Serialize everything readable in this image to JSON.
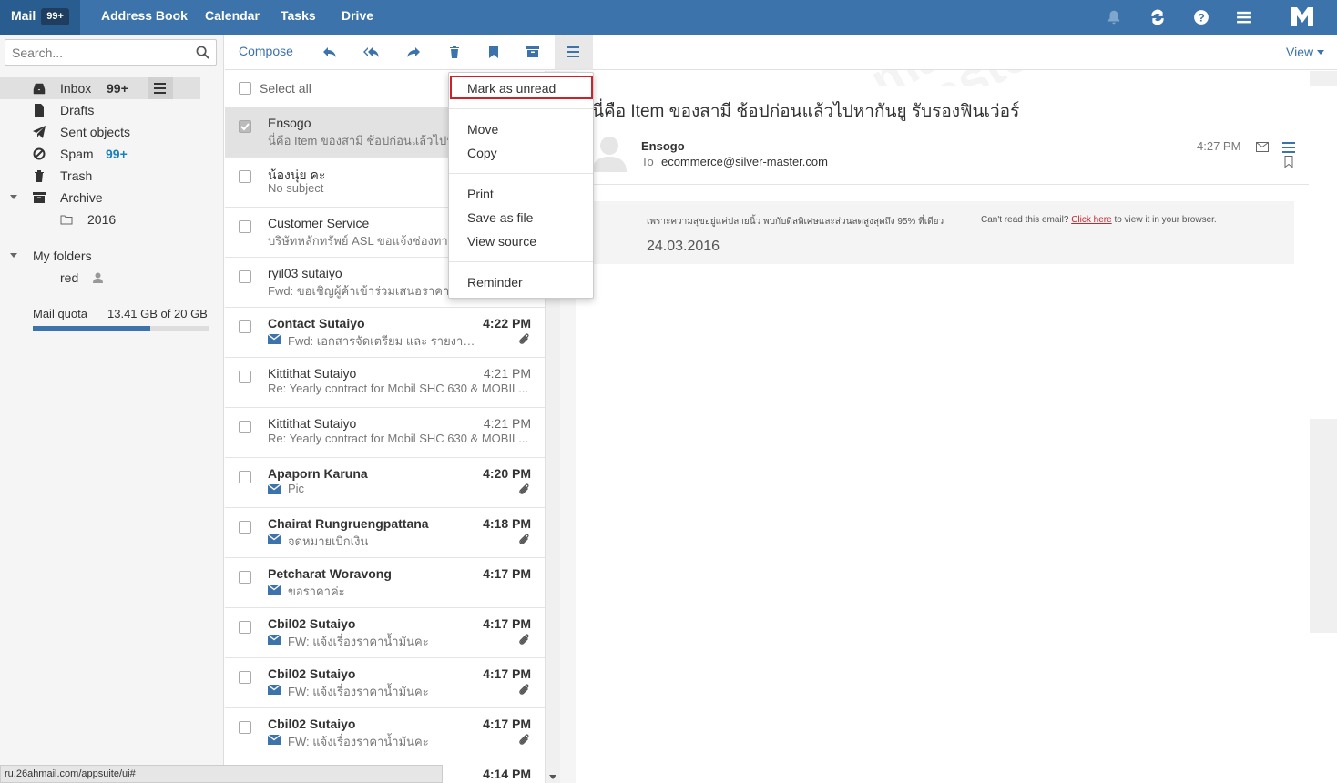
{
  "topbar": {
    "apps": [
      {
        "label": "Mail",
        "badge": "99+"
      },
      {
        "label": "Address Book"
      },
      {
        "label": "Calendar"
      },
      {
        "label": "Tasks"
      },
      {
        "label": "Drive"
      }
    ],
    "icons": [
      "bell-icon",
      "refresh-icon",
      "help-icon",
      "menu-icon",
      "mailmaster-logo"
    ]
  },
  "search": {
    "placeholder": "Search..."
  },
  "folders": {
    "inbox": {
      "label": "Inbox",
      "count": "99+"
    },
    "drafts": {
      "label": "Drafts"
    },
    "sent": {
      "label": "Sent objects"
    },
    "spam": {
      "label": "Spam",
      "count": "99+"
    },
    "trash": {
      "label": "Trash"
    },
    "archive": {
      "label": "Archive"
    },
    "archive_2016": {
      "label": "2016"
    },
    "my_folders": {
      "label": "My folders"
    },
    "red": {
      "label": "red"
    }
  },
  "quota": {
    "label": "Mail quota",
    "value": "13.41 GB of 20 GB",
    "fraction": 0.67
  },
  "toolbar": {
    "compose": "Compose",
    "view": "View"
  },
  "list": {
    "select_all": "Select all",
    "rows": [
      {
        "from": "Ensogo",
        "subject": "นี่คือ Item ของสามี ช้อปก่อนแล้วไปหากันยู",
        "time": "",
        "unread": false,
        "selected": true,
        "attach": false
      },
      {
        "from": "น้องนุ่ย คะ",
        "subject": "No subject",
        "time": "",
        "unread": false,
        "selected": false,
        "attach": false
      },
      {
        "from": "Customer Service",
        "subject": "บริษัทหลักทรัพย์ ASL ขอแจ้งช่องทางการ",
        "time": "",
        "unread": false,
        "selected": false,
        "attach": false
      },
      {
        "from": "ryil03 sutaiyo",
        "subject": "Fwd: ขอเชิญผู้ค้าเข้าร่วมเสนอราคางาน",
        "time": "",
        "unread": false,
        "selected": false,
        "attach": false
      },
      {
        "from": "Contact Sutaiyo",
        "subject": "Fwd: เอกสารจัดเตรียม และ รายงานการประ...",
        "time": "4:22 PM",
        "unread": true,
        "selected": false,
        "attach": true
      },
      {
        "from": "Kittithat Sutaiyo",
        "subject": "Re: Yearly contract for Mobil SHC 630 & MOBIL...",
        "time": "4:21 PM",
        "unread": false,
        "selected": false,
        "attach": false
      },
      {
        "from": "Kittithat Sutaiyo",
        "subject": "Re: Yearly contract for Mobil SHC 630 & MOBIL...",
        "time": "4:21 PM",
        "unread": false,
        "selected": false,
        "attach": false
      },
      {
        "from": "Apaporn Karuna",
        "subject": "Pic",
        "time": "4:20 PM",
        "unread": true,
        "selected": false,
        "attach": true
      },
      {
        "from": "Chairat Rungruengpattana",
        "subject": "จดหมายเบิกเงิน",
        "time": "4:18 PM",
        "unread": true,
        "selected": false,
        "attach": true
      },
      {
        "from": "Petcharat Woravong",
        "subject": "ขอราคาค่ะ",
        "time": "4:17 PM",
        "unread": true,
        "selected": false,
        "attach": false
      },
      {
        "from": "Cbil02 Sutaiyo",
        "subject": "FW: แจ้งเรื่องราคาน้ำมันคะ",
        "time": "4:17 PM",
        "unread": true,
        "selected": false,
        "attach": true
      },
      {
        "from": "Cbil02 Sutaiyo",
        "subject": "FW: แจ้งเรื่องราคาน้ำมันคะ",
        "time": "4:17 PM",
        "unread": true,
        "selected": false,
        "attach": true
      },
      {
        "from": "Cbil02 Sutaiyo",
        "subject": "FW: แจ้งเรื่องราคาน้ำมันคะ",
        "time": "4:17 PM",
        "unread": true,
        "selected": false,
        "attach": true
      },
      {
        "from": "",
        "subject": "",
        "time": "4:14 PM",
        "unread": true,
        "selected": false,
        "attach": false
      }
    ]
  },
  "dropdown": {
    "mark_unread": "Mark as unread",
    "move": "Move",
    "copy": "Copy",
    "print": "Print",
    "save_as_file": "Save as file",
    "view_source": "View source",
    "reminder": "Reminder"
  },
  "message": {
    "subject": "นี่คือ Item ของสามี ช้อปก่อนแล้วไปหากันยู รับรองฟินเว่อร์",
    "sender": "Ensogo",
    "to_label": "To",
    "to_address": "ecommerce@silver-master.com",
    "time": "4:27 PM",
    "banner_text": "เพราะความสุขอยู่แค่ปลายนิ้ว พบกับดีลพิเศษและส่วนลดสูงสุดถึง 95% ที่เดียว",
    "banner_date": "24.03.2016",
    "banner_cant_read": "Can't read this email?",
    "banner_link": "Click here",
    "banner_after": "to view it in your browser."
  },
  "status_url": "ru.26ahmail.com/appsuite/ui#",
  "watermark": {
    "line1": "mail",
    "line2": "master"
  },
  "colors": {
    "accent": "#3c73aa",
    "highlight": "#d0202a",
    "spam_count": "#1a7fc1"
  }
}
